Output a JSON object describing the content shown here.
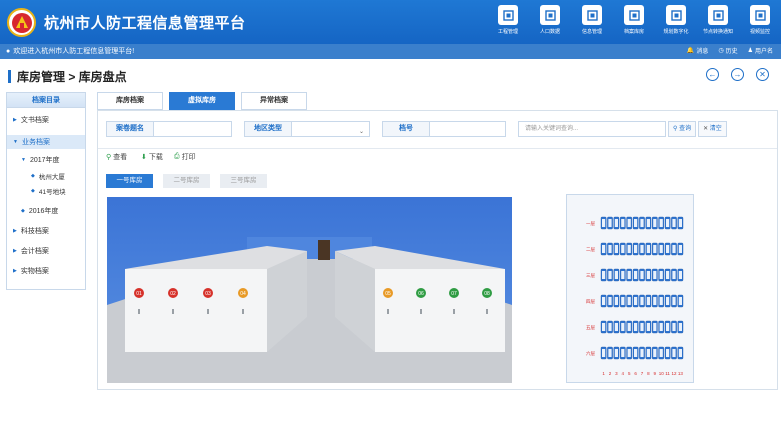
{
  "app": {
    "title": "杭州市人防工程信息管理平台"
  },
  "nav": [
    {
      "label": "工程管理",
      "icon": "gear-building-icon"
    },
    {
      "label": "人口数据",
      "icon": "data-icon"
    },
    {
      "label": "信息管理",
      "icon": "info-icon"
    },
    {
      "label": "档案库房",
      "icon": "archive-warehouse-icon"
    },
    {
      "label": "规划数字化",
      "icon": "planning-icon"
    },
    {
      "label": "节点转换通知",
      "icon": "node-icon"
    },
    {
      "label": "视频监控",
      "icon": "camera-icon"
    }
  ],
  "subbar": {
    "welcome": "欢迎进入杭州市人防工程信息管理平台!",
    "actions": [
      "消息",
      "历史",
      "用户名"
    ]
  },
  "breadcrumb": {
    "text": "库房管理 > 库房盘点"
  },
  "sidebar": {
    "header": "档案目录",
    "items": [
      "文书档案",
      "业务档案",
      "科技档案",
      "会计档案",
      "实物档案"
    ],
    "year_2017": "2017年度",
    "sub_a": "杭州大厦",
    "sub_b": "41号地块",
    "year_2016": "2016年度"
  },
  "tabs": [
    "库房档案",
    "虚拟库房",
    "异常档案"
  ],
  "filters": {
    "label1": "案卷题名",
    "label2": "地区类型",
    "label3": "档号",
    "placeholder": "请输入关键词查询...",
    "search": "查询",
    "clear": "清空"
  },
  "actions": {
    "view": "查看",
    "download": "下载",
    "print": "打印"
  },
  "rooms": [
    "一号库房",
    "二号库房",
    "三号库房"
  ],
  "shelf_labels_left": [
    "01",
    "02",
    "03",
    "04"
  ],
  "shelf_labels_right": [
    "05",
    "06",
    "07",
    "08"
  ],
  "shelf_colors": [
    "#d6312a",
    "#d6312a",
    "#d6312a",
    "#e89a26",
    "#e89a26",
    "#2f9c43",
    "#2f9c43",
    "#2f9c43"
  ],
  "rack_rows": [
    "一层",
    "二层",
    "三层",
    "四层",
    "五层",
    "六层"
  ],
  "rack_cols": [
    "1",
    "2",
    "3",
    "4",
    "5",
    "6",
    "7",
    "8",
    "9",
    "10",
    "11",
    "12",
    "13"
  ]
}
